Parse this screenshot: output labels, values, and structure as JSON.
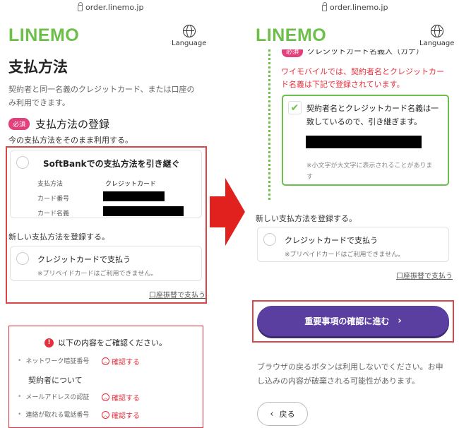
{
  "browser": {
    "url": "order.linemo.jp"
  },
  "header": {
    "logo": "LINEMO",
    "language": "Language"
  },
  "left": {
    "page_title": "支払方法",
    "intro": [
      "契約者と同一名義のクレジットカード、または口座の",
      "み利用できます。"
    ],
    "required_badge": "必須",
    "section_title": "支払方法の登録",
    "keep_current": "今の支払方法をそのまま利用する。",
    "softbank_option": {
      "title": "SoftBankでの支払方法を引き継ぐ",
      "rows": [
        {
          "label": "支払方法",
          "value": "クレジットカード"
        },
        {
          "label": "カード番号",
          "value": ""
        },
        {
          "label": "カード名義",
          "value": ""
        }
      ]
    },
    "register_new": "新しい支払方法を登録する。",
    "credit_option": {
      "title": "クレジットカードで支払う",
      "note": "※プリペイドカードはご利用できません。"
    },
    "bank_link": "口座振替で支払う",
    "confirm_box": {
      "title": "以下の内容をご確認ください。",
      "items": [
        {
          "label": "ネットワーク暗証番号",
          "action": "確認する"
        },
        {
          "label": "メールアドレスの認証",
          "action": "確認する"
        },
        {
          "label": "連絡が取れる電話番号",
          "action": "確認する"
        }
      ],
      "subheading": "契約者について"
    }
  },
  "right": {
    "partial_label": "クレジットカード名義人（カナ）",
    "warning": [
      "ワイモバイルでは、契約者名とクレジットカー",
      "ド名義は下記で登録されています。"
    ],
    "check_text": [
      "契約者名とクレジットカード名義は一",
      "致しているので、引き継ぎます。"
    ],
    "check_note": [
      "※小文字が大文字に表示されることがありま",
      "す"
    ],
    "register_new": "新しい支払方法を登録する。",
    "credit_option": {
      "title": "クレジットカードで支払う",
      "note": "※プリペイドカードはご利用できません。"
    },
    "bank_link": "口座振替で支払う",
    "proceed_button": "重要事項の確認に進む",
    "browser_note": [
      "ブラウザの戻るボタンは利用しないでください。お申",
      "し込みの内容が破棄される可能性があります。"
    ],
    "back_button": "戻る"
  },
  "colors": {
    "brand": "#6cc04a",
    "highlight": "#d9464a",
    "button": "#5b3fa0",
    "arrow": "#e1211e"
  }
}
